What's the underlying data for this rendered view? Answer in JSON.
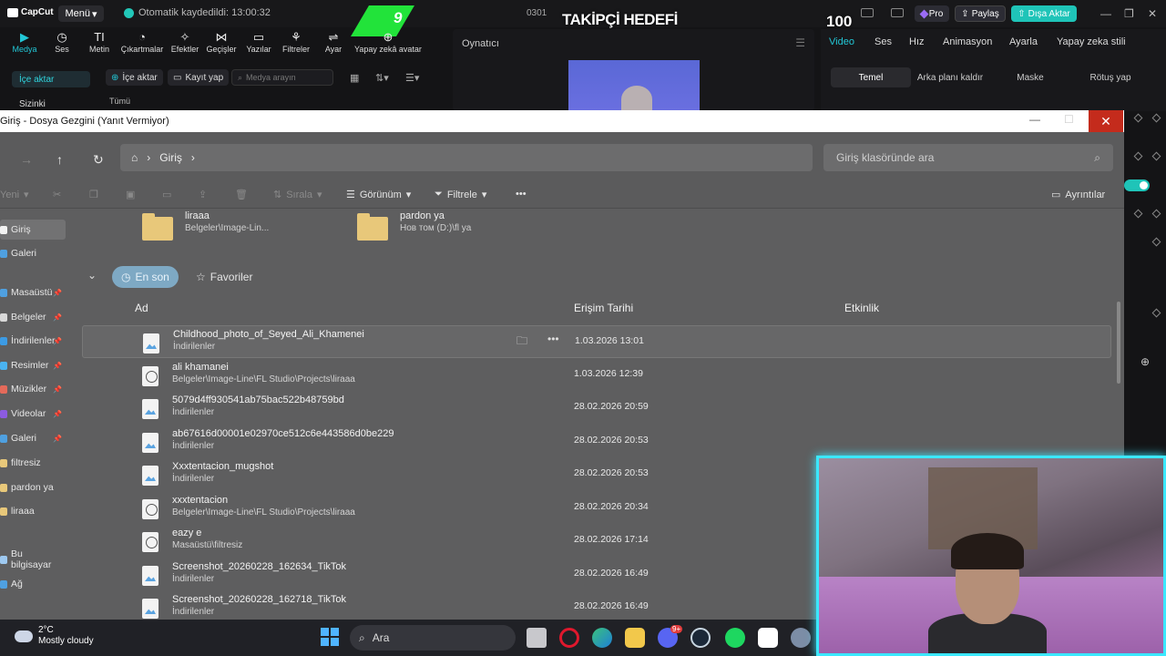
{
  "capcut": {
    "logo": "CapCut",
    "menu_label": "Menü",
    "autosave": "Otomatik kaydedildi: 13:00:32",
    "project_name": "0301",
    "overlay": {
      "goal_count": "9",
      "goal_title": "TAKİPÇİ HEDEFİ",
      "goal_target": "100"
    },
    "pro_label": "Pro",
    "share_label": "Paylaş",
    "export_label": "Dışa Aktar",
    "tools": [
      {
        "label": "Medya",
        "icon": "media-icon"
      },
      {
        "label": "Ses",
        "icon": "audio-icon"
      },
      {
        "label": "Metin",
        "icon": "text-icon"
      },
      {
        "label": "Çıkartmalar",
        "icon": "sticker-icon"
      },
      {
        "label": "Efektler",
        "icon": "effects-icon"
      },
      {
        "label": "Geçişler",
        "icon": "transition-icon"
      },
      {
        "label": "Yazılar",
        "icon": "captions-icon"
      },
      {
        "label": "Filtreler",
        "icon": "filter-icon"
      },
      {
        "label": "Ayar",
        "icon": "adjust-icon"
      },
      {
        "label": "Yapay zekâ avatar",
        "icon": "ai-avatar-icon"
      }
    ],
    "left_nav": {
      "import": "İçe aktar",
      "yours": "Sizinki"
    },
    "media_bar": {
      "import_btn": "İçe aktar",
      "record_btn": "Kayıt yap",
      "search_placeholder": "Medya arayın",
      "filter_all": "Tümü"
    },
    "player_title": "Oynatıcı",
    "right_tabs": [
      "Video",
      "Ses",
      "Hız",
      "Animasyon",
      "Ayarla",
      "Yapay zeka stili"
    ],
    "right_subtabs": [
      "Temel",
      "Arka planı kaldır",
      "Maske",
      "Rötuş yap"
    ]
  },
  "explorer": {
    "title": "Giriş - Dosya Gezgini (Yanıt Vermiyor)",
    "address": "Giriş",
    "search_placeholder": "Giriş klasöründe ara",
    "commands": {
      "new": "Yeni",
      "sort": "Sırala",
      "view": "Görünüm",
      "filter": "Filtrele",
      "details": "Ayrıntılar"
    },
    "sidebar": [
      {
        "label": "Giriş",
        "pinned": false
      },
      {
        "label": "Galeri",
        "pinned": false
      },
      {
        "label": "Masaüstü",
        "pinned": true
      },
      {
        "label": "Belgeler",
        "pinned": true
      },
      {
        "label": "İndirilenler",
        "pinned": true
      },
      {
        "label": "Resimler",
        "pinned": true
      },
      {
        "label": "Müzikler",
        "pinned": true
      },
      {
        "label": "Videolar",
        "pinned": true
      },
      {
        "label": "Galeri",
        "pinned": true
      },
      {
        "label": "filtresiz",
        "pinned": false
      },
      {
        "label": "pardon ya",
        "pinned": false
      },
      {
        "label": "liraaa",
        "pinned": false
      },
      {
        "label": "Bu bilgisayar",
        "pinned": false
      },
      {
        "label": "Ağ",
        "pinned": false
      }
    ],
    "quick_folders": [
      {
        "name": "liraaa",
        "path": "Belgeler\\Image-Lin..."
      },
      {
        "name": "pardon ya",
        "path": "Нов том (D:)\\fl ya"
      }
    ],
    "pills": {
      "recent": "En son",
      "favorites": "Favoriler"
    },
    "columns": {
      "name": "Ad",
      "date": "Erişim Tarihi",
      "activity": "Etkinlik"
    },
    "files": [
      {
        "name": "Childhood_photo_of_Seyed_Ali_Khamenei",
        "location": "İndirilenler",
        "date": "1.03.2026 13:01",
        "type": "image"
      },
      {
        "name": "ali khamanei",
        "location": "Belgeler\\Image-Line\\FL Studio\\Projects\\liraaa",
        "date": "1.03.2026 12:39",
        "type": "video"
      },
      {
        "name": "5079d4ff930541ab75bac522b48759bd",
        "location": "İndirilenler",
        "date": "28.02.2026 20:59",
        "type": "image"
      },
      {
        "name": "ab67616d00001e02970ce512c6e443586d0be229",
        "location": "İndirilenler",
        "date": "28.02.2026 20:53",
        "type": "image"
      },
      {
        "name": "Xxxtentacion_mugshot",
        "location": "İndirilenler",
        "date": "28.02.2026 20:53",
        "type": "image"
      },
      {
        "name": "xxxtentacion",
        "location": "Belgeler\\Image-Line\\FL Studio\\Projects\\liraaa",
        "date": "28.02.2026 20:34",
        "type": "video"
      },
      {
        "name": "eazy e",
        "location": "Masaüstü\\filtresiz",
        "date": "28.02.2026 17:14",
        "type": "video"
      },
      {
        "name": "Screenshot_20260228_162634_TikTok",
        "location": "İndirilenler",
        "date": "28.02.2026 16:49",
        "type": "image"
      },
      {
        "name": "Screenshot_20260228_162718_TikTok",
        "location": "İndirilenler",
        "date": "28.02.2026 16:49",
        "type": "image"
      }
    ]
  },
  "taskbar": {
    "weather_temp": "2°C",
    "weather_desc": "Mostly cloudy",
    "search_label": "Ara",
    "discord_badge": "9+"
  }
}
